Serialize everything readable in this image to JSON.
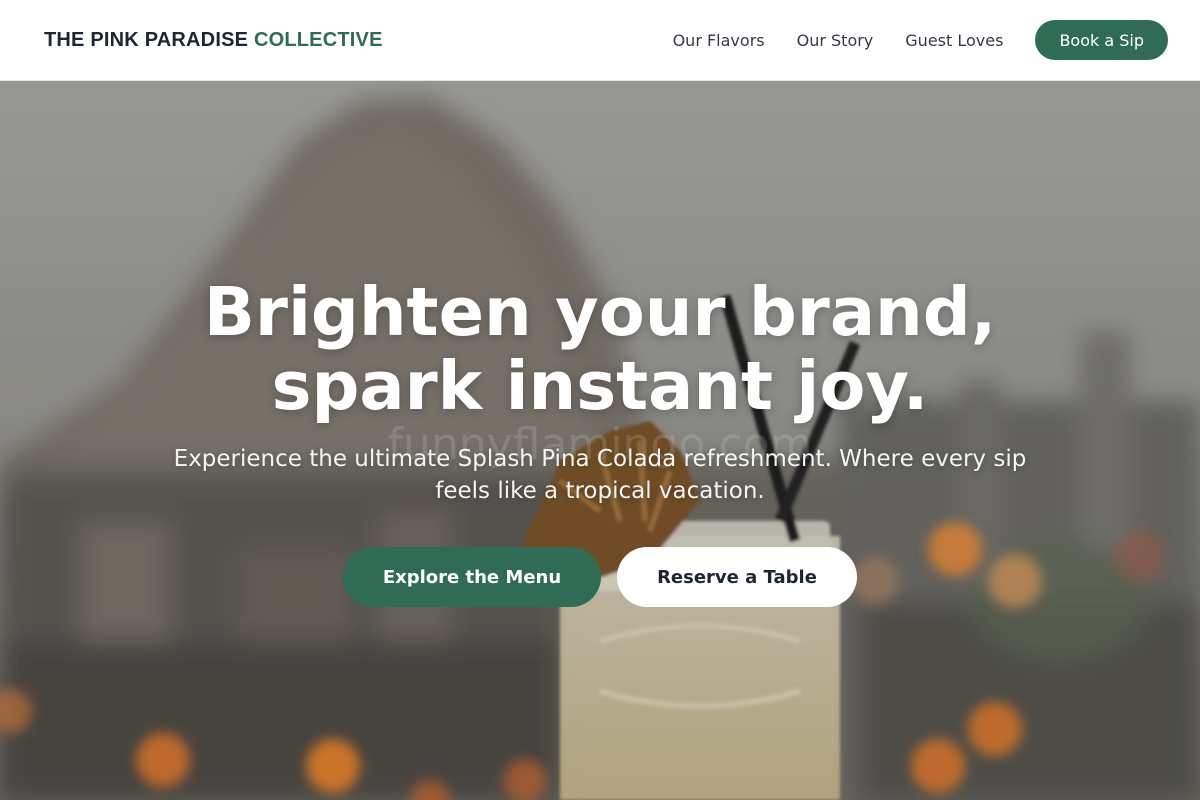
{
  "navbar": {
    "brand_main": "THE PINK PARADISE",
    "brand_accent": "COLLECTIVE",
    "links": [
      "Our Flavors",
      "Our Story",
      "Guest Loves"
    ],
    "cta_label": "Book a Sip"
  },
  "hero": {
    "headline_line1": "Brighten your brand,",
    "headline_line2": "spark instant joy.",
    "subtext": "Experience the ultimate Splash Pina Colada refreshment. Where every sip feels like a tropical vacation.",
    "primary_button": "Explore the Menu",
    "secondary_button": "Reserve a Table",
    "image_watermark": "funnyflamingo.com"
  },
  "colors": {
    "accent_green": "#2f6b55",
    "brand_dark": "#1f2633",
    "nav_text": "#333a44",
    "hero_text": "#ffffff"
  },
  "icons": {
    "hero_image": "cocktail-photo"
  }
}
